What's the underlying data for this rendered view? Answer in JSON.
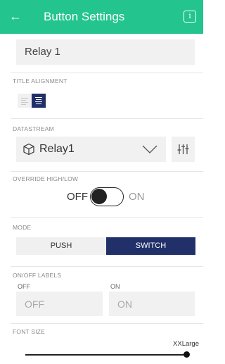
{
  "header": {
    "back_icon": "arrow-left-icon",
    "title": "Button Settings",
    "info_icon": "info-icon",
    "info_glyph": "i",
    "color": "#23c48e"
  },
  "name_field": {
    "value": "Relay 1"
  },
  "title_alignment": {
    "label": "TITLE ALIGNMENT",
    "options": [
      "left",
      "center"
    ],
    "selected": "center"
  },
  "datastream": {
    "label": "DATASTREAM",
    "value": "Relay1",
    "icon": "cube-icon",
    "settings_icon": "sliders-icon"
  },
  "override": {
    "label": "OVERRIDE HIGH/LOW",
    "off_label": "OFF",
    "on_label": "ON",
    "state": "off"
  },
  "mode": {
    "label": "MODE",
    "options": [
      "PUSH",
      "SWITCH"
    ],
    "selected": "SWITCH",
    "active_color": "#22306a"
  },
  "labels": {
    "label": "ON/OFF LABELS",
    "off_caption": "OFF",
    "off_value": "OFF",
    "on_caption": "ON",
    "on_value": "ON"
  },
  "font_size": {
    "label": "FONT SIZE",
    "value": "XXLarge",
    "level": 1.0
  }
}
